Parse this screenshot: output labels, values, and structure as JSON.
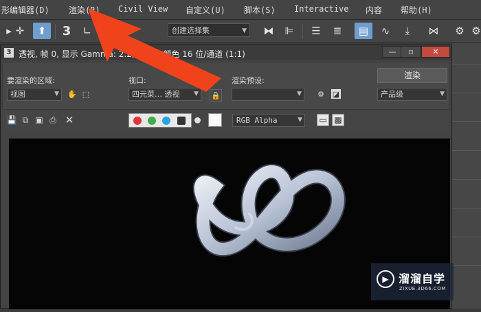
{
  "menubar": {
    "items": [
      "形编辑器(D)",
      "渲染(R)",
      "Civil View",
      "自定义(U)",
      "脚本(S)",
      "Interactive",
      "内容",
      "帮助(H)"
    ]
  },
  "toolbar": {
    "percent_label": "%",
    "angle_label": "3",
    "selection_set_placeholder": "创建选择集"
  },
  "frame_window": {
    "title": "透视, 帧 0, 显示 Gamma: 2.2, RGBA 颜色 16 位/通道 (1:1)",
    "app_icon_label": "3",
    "area_label": "要渲染的区域:",
    "area_value": "视图",
    "viewport_label": "视口:",
    "viewport_value": "四元菜… 透视",
    "preset_label": "渲染预设:",
    "preset_value": "",
    "render_button": "渲染",
    "quality_value": "产品级",
    "channel_value": "RGB Alpha"
  },
  "colors": {
    "red_channel": "#e0333a",
    "green_channel": "#3cae4a",
    "blue_channel": "#27a7e0",
    "arrow": "#f0431c",
    "accent": "#6d9ecf"
  },
  "watermark": {
    "title": "溜溜自学",
    "subtitle": "ZIXUE.3D66.COM"
  }
}
